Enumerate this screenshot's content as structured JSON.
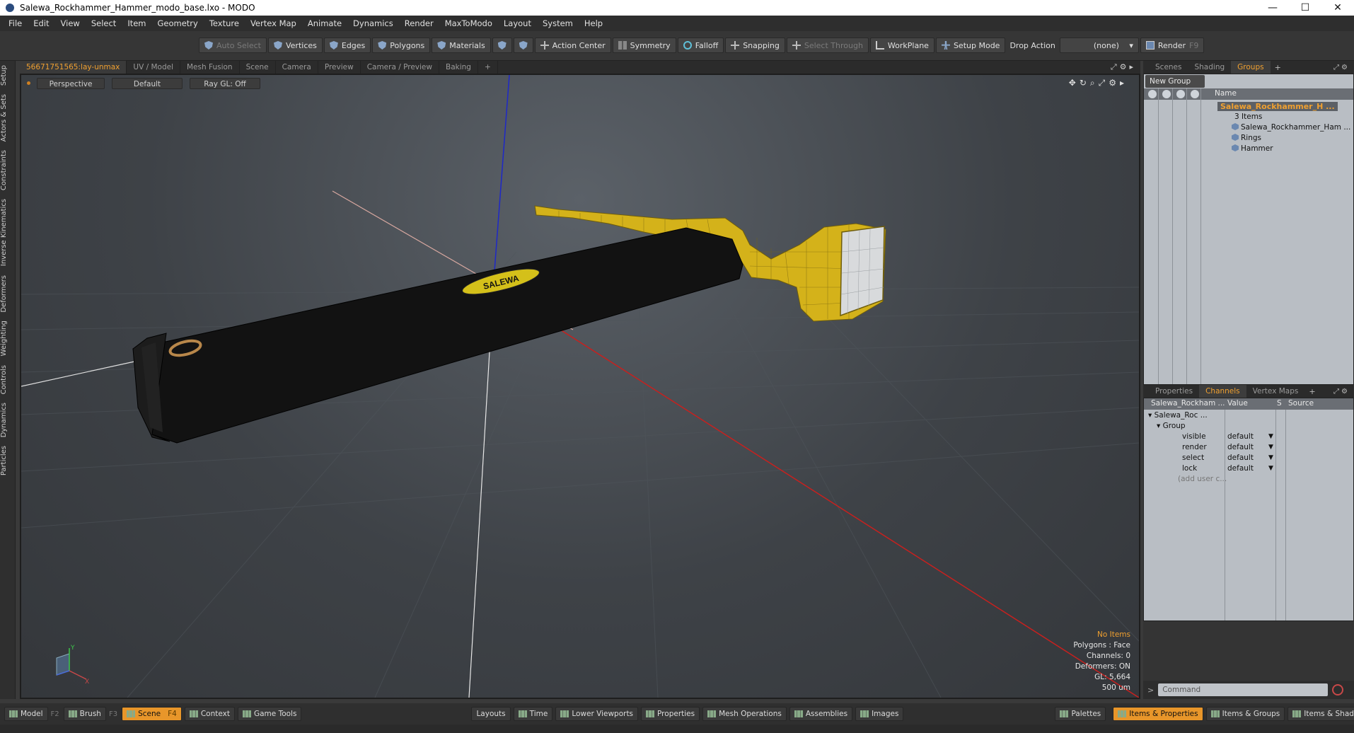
{
  "window": {
    "title": "Salewa_Rockhammer_Hammer_modo_base.lxo - MODO",
    "minimize": "—",
    "maximize": "☐",
    "close": "✕"
  },
  "menu": [
    "File",
    "Edit",
    "View",
    "Select",
    "Item",
    "Geometry",
    "Texture",
    "Vertex Map",
    "Animate",
    "Dynamics",
    "Render",
    "MaxToModo",
    "Layout",
    "System",
    "Help"
  ],
  "toolbar": {
    "auto_select": "Auto Select",
    "vertices": "Vertices",
    "edges": "Edges",
    "polygons": "Polygons",
    "materials": "Materials",
    "action_center": "Action Center",
    "symmetry": "Symmetry",
    "falloff": "Falloff",
    "snapping": "Snapping",
    "select_through": "Select Through",
    "workplane": "WorkPlane",
    "setup_mode": "Setup Mode",
    "drop_action": "Drop Action",
    "drop_value": "(none)",
    "render": "Render",
    "render_key": "F9"
  },
  "left_tabs": [
    "Setup",
    "Actors & Sets",
    "Constraints",
    "Inverse Kinematics",
    "Deformers",
    "Weighting",
    "Controls",
    "Dynamics",
    "Particles"
  ],
  "viewport_tabs": [
    "56671751565:lay-unmax",
    "UV / Model",
    "Mesh Fusion",
    "Scene",
    "Camera",
    "Preview",
    "Camera / Preview",
    "Baking",
    "+"
  ],
  "viewport": {
    "view": "Perspective",
    "shading": "Default",
    "raygl": "Ray GL: Off",
    "logo_text": "SALEWA",
    "info": {
      "items": "No Items",
      "polygons": "Polygons : Face",
      "channels": "Channels: 0",
      "deformers": "Deformers: ON",
      "gl": "GL: 5,664",
      "scale": "500 um"
    },
    "gizmo": {
      "y": "Y",
      "x": "X"
    }
  },
  "right_tabs": [
    "Scenes",
    "Shading",
    "Groups",
    "+"
  ],
  "groups": {
    "new_group": "New Group",
    "col_name": "Name",
    "root": "Salewa_Rockhammer_H ...",
    "count": "3 Items",
    "children": [
      "Salewa_Rockhammer_Ham ...",
      "Rings",
      "Hammer"
    ]
  },
  "props_tabs": [
    "Properties",
    "Channels",
    "Vertex Maps",
    "+"
  ],
  "channels": {
    "col_item": "Salewa_Rockham ...",
    "col_value": "Value",
    "col_s": "S",
    "col_source": "Source",
    "root": "Salewa_Roc ...",
    "group": "Group",
    "rows": [
      {
        "name": "visible",
        "value": "default"
      },
      {
        "name": "render",
        "value": "default"
      },
      {
        "name": "select",
        "value": "default"
      },
      {
        "name": "lock",
        "value": "default"
      }
    ],
    "add_user": "(add user c..."
  },
  "command": {
    "prompt": ">",
    "placeholder": "Command"
  },
  "bottom": {
    "model": "Model",
    "model_key": "F2",
    "brush": "Brush",
    "brush_key": "F3",
    "scene": "Scene",
    "scene_key": "F4",
    "context": "Context",
    "game_tools": "Game Tools",
    "layouts": "Layouts",
    "time": "Time",
    "lower_viewports": "Lower Viewports",
    "properties": "Properties",
    "mesh_operations": "Mesh Operations",
    "assemblies": "Assemblies",
    "images": "Images",
    "palettes": "Palettes",
    "items_properties": "Items & Properties",
    "items_groups": "Items & Groups",
    "items_shading": "Items & Shading"
  },
  "colors": {
    "accent": "#f0a030",
    "hammer_yellow": "#d4b21a",
    "handle": "#121212",
    "axis_x": "#c8201e",
    "axis_y": "#ffffff",
    "axis_z": "#1e28c8"
  }
}
